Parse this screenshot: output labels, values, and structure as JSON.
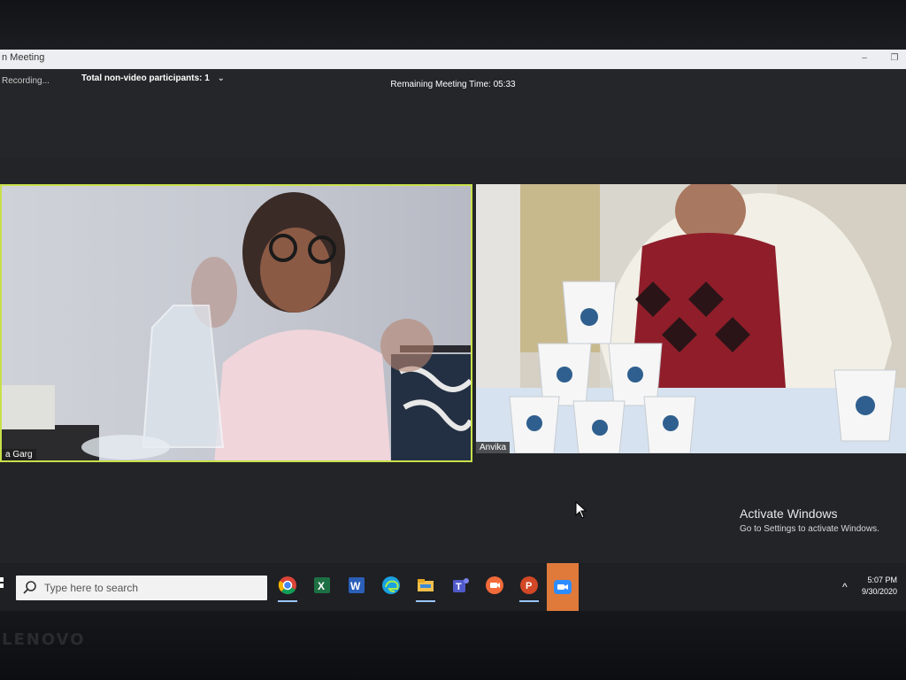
{
  "window": {
    "title": "n Meeting"
  },
  "toolbar": {
    "recording": "Recording...",
    "participants": "Total non-video participants: 1",
    "participants_caret": "⌄",
    "remaining": "Remaining Meeting Time: 05:33"
  },
  "videos": {
    "left_name": "a Garg",
    "right_name": "Anvika"
  },
  "watermark": {
    "line1": "Activate Windows",
    "line2": "Go to Settings to activate Windows."
  },
  "taskbar": {
    "search_placeholder": "Type here to search",
    "time": "5:07 PM",
    "date": "9/30/2020",
    "icons": [
      "chrome-icon",
      "excel-icon",
      "word-icon",
      "edge-icon",
      "file-explorer-icon",
      "teams-icon",
      "zoom-webinar-icon",
      "powerpoint-icon",
      "zoom-icon"
    ]
  },
  "colors": {
    "active_speaker_border": "#c8e04a",
    "taskbar": "#1f2024",
    "toolbar": "#252629"
  }
}
